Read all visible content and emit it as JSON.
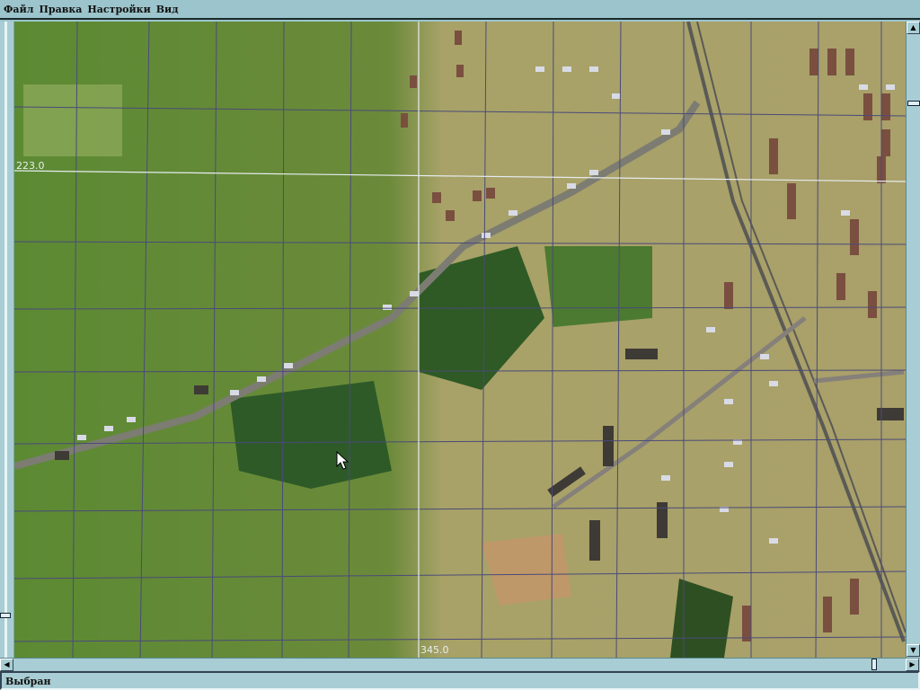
{
  "menu": {
    "items": [
      "Файл",
      "Правка",
      "Настройки",
      "Вид"
    ]
  },
  "map": {
    "labels": {
      "y_coord": "223.0",
      "x_coord": "345.0"
    }
  },
  "status": {
    "text": "Выбран"
  },
  "colors": {
    "chrome": "#9cc4cc",
    "field_green": "#5f8a35",
    "ground_beige": "#b3a970"
  }
}
